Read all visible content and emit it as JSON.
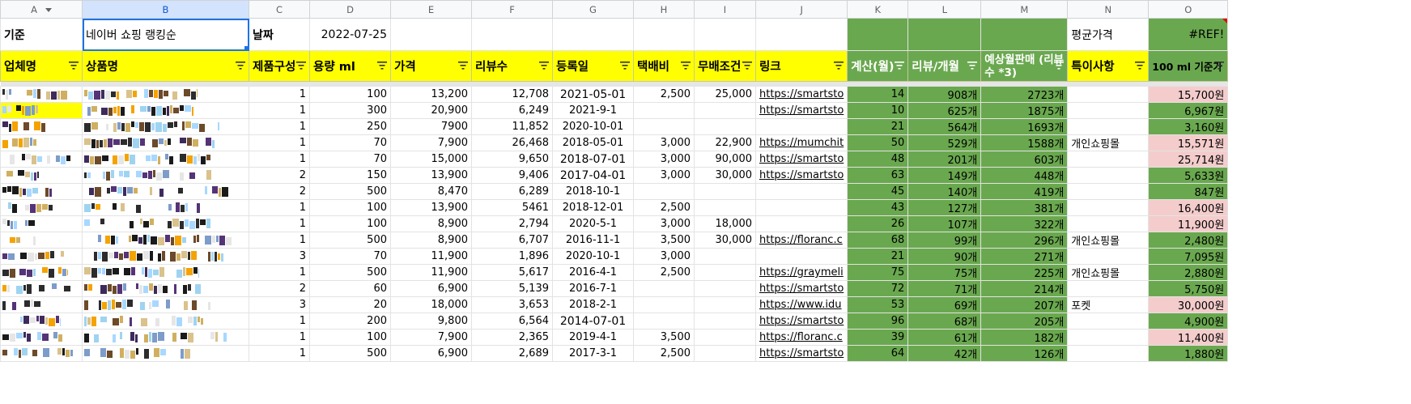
{
  "columns": [
    "A",
    "B",
    "C",
    "D",
    "E",
    "F",
    "G",
    "H",
    "I",
    "J",
    "K",
    "L",
    "M",
    "N",
    "O"
  ],
  "row1": {
    "a": "기준",
    "b": "네이버 쇼핑 랭킹순",
    "c": "날짜",
    "d": "2022-07-25",
    "n": "평균가격",
    "o": "#REF!"
  },
  "headers": {
    "a": "업체명",
    "b": "상품명",
    "c": "제품구성",
    "d": "용량 ml",
    "e": "가격",
    "f": "리뷰수",
    "g": "등록일",
    "h": "택배비",
    "i": "무배조건",
    "j": "링크",
    "k": "계산(월)",
    "l": "리뷰/개월",
    "m": "예상월판매 (리뷰수 *3)",
    "n": "특이사항",
    "o": "100 ml 기준가"
  },
  "rows": [
    {
      "c": "1",
      "d": "100",
      "e": "13,200",
      "f": "12,708",
      "g": "2021-05-01",
      "gbig": true,
      "h": "2,500",
      "i": "25,000",
      "j": "https://smartsto",
      "k": "14",
      "l": "908개",
      "m": "2723개",
      "n": "",
      "o": "15,700원",
      "pink": true
    },
    {
      "c": "1",
      "d": "300",
      "e": "20,900",
      "f": "6,249",
      "g": "2021-9-1",
      "gbig": false,
      "h": "",
      "i": "",
      "j": "https://smartsto",
      "k": "10",
      "l": "625개",
      "m": "1875개",
      "n": "",
      "o": "6,967원",
      "pink": false
    },
    {
      "c": "1",
      "d": "250",
      "e": "7900",
      "f": "11,852",
      "g": "2020-10-01",
      "gbig": false,
      "h": "",
      "i": "",
      "j": "",
      "k": "21",
      "l": "564개",
      "m": "1693개",
      "n": "",
      "o": "3,160원",
      "pink": false
    },
    {
      "c": "1",
      "d": "70",
      "e": "7,900",
      "f": "26,468",
      "g": "2018-05-01",
      "gbig": false,
      "h": "3,000",
      "i": "22,900",
      "j": "https://mumchit",
      "k": "50",
      "l": "529개",
      "m": "1588개",
      "n": "개인쇼핑몰",
      "o": "15,571원",
      "pink": true
    },
    {
      "c": "1",
      "d": "70",
      "e": "15,000",
      "f": "9,650",
      "g": "2018-07-01",
      "gbig": true,
      "h": "3,000",
      "i": "90,000",
      "j": "https://smartsto",
      "k": "48",
      "l": "201개",
      "m": "603개",
      "n": "",
      "o": "25,714원",
      "pink": true
    },
    {
      "c": "2",
      "d": "150",
      "e": "13,900",
      "f": "9,406",
      "g": "2017-04-01",
      "gbig": true,
      "h": "3,000",
      "i": "30,000",
      "j": "https://smartsto",
      "k": "63",
      "l": "149개",
      "m": "448개",
      "n": "",
      "o": "5,633원",
      "pink": false
    },
    {
      "c": "2",
      "d": "500",
      "e": "8,470",
      "f": "6,289",
      "g": "2018-10-1",
      "gbig": false,
      "h": "",
      "i": "",
      "j": "",
      "k": "45",
      "l": "140개",
      "m": "419개",
      "n": "",
      "o": "847원",
      "pink": false
    },
    {
      "c": "1",
      "d": "100",
      "e": "13,900",
      "f": "5461",
      "g": "2018-12-01",
      "gbig": false,
      "h": "2,500",
      "i": "",
      "j": "",
      "k": "43",
      "l": "127개",
      "m": "381개",
      "n": "",
      "o": "16,400원",
      "pink": true
    },
    {
      "c": "1",
      "d": "100",
      "e": "8,900",
      "f": "2,794",
      "g": "2020-5-1",
      "gbig": false,
      "h": "3,000",
      "i": "18,000",
      "j": "",
      "k": "26",
      "l": "107개",
      "m": "322개",
      "n": "",
      "o": "11,900원",
      "pink": true
    },
    {
      "c": "1",
      "d": "500",
      "e": "8,900",
      "f": "6,707",
      "g": "2016-11-1",
      "gbig": false,
      "h": "3,500",
      "i": "30,000",
      "j": "https://floranc.c",
      "k": "68",
      "l": "99개",
      "m": "296개",
      "n": "개인쇼핑몰",
      "o": "2,480원",
      "pink": false
    },
    {
      "c": "3",
      "d": "70",
      "e": "11,900",
      "f": "1,896",
      "g": "2020-10-1",
      "gbig": false,
      "h": "3,000",
      "i": "",
      "j": "",
      "k": "21",
      "l": "90개",
      "m": "271개",
      "n": "",
      "o": "7,095원",
      "pink": false
    },
    {
      "c": "1",
      "d": "500",
      "e": "11,900",
      "f": "5,617",
      "g": "2016-4-1",
      "gbig": false,
      "h": "2,500",
      "i": "",
      "j": "https://graymeli",
      "k": "75",
      "l": "75개",
      "m": "225개",
      "n": "개인쇼핑몰",
      "o": "2,880원",
      "pink": false
    },
    {
      "c": "2",
      "d": "60",
      "e": "6,900",
      "f": "5,139",
      "g": "2016-7-1",
      "gbig": false,
      "h": "",
      "i": "",
      "j": "https://smartsto",
      "k": "72",
      "l": "71개",
      "m": "214개",
      "n": "",
      "o": "5,750원",
      "pink": false
    },
    {
      "c": "3",
      "d": "20",
      "e": "18,000",
      "f": "3,653",
      "g": "2018-2-1",
      "gbig": false,
      "h": "",
      "i": "",
      "j": "https://www.idu",
      "k": "53",
      "l": "69개",
      "m": "207개",
      "n": "포켓",
      "o": "30,000원",
      "pink": true
    },
    {
      "c": "1",
      "d": "200",
      "e": "9,800",
      "f": "6,564",
      "g": "2014-07-01",
      "gbig": true,
      "h": "",
      "i": "",
      "j": "https://smartsto",
      "k": "96",
      "l": "68개",
      "m": "205개",
      "n": "",
      "o": "4,900원",
      "pink": false
    },
    {
      "c": "1",
      "d": "100",
      "e": "7,900",
      "f": "2,365",
      "g": "2019-4-1",
      "gbig": false,
      "h": "3,500",
      "i": "",
      "j": "https://floranc.c",
      "k": "39",
      "l": "61개",
      "m": "182개",
      "n": "",
      "o": "11,400원",
      "pink": true
    },
    {
      "c": "1",
      "d": "500",
      "e": "6,900",
      "f": "2,689",
      "g": "2017-3-1",
      "gbig": false,
      "h": "2,500",
      "i": "",
      "j": "https://smartsto",
      "k": "64",
      "l": "42개",
      "m": "126개",
      "n": "",
      "o": "1,880원",
      "pink": false
    }
  ],
  "colors": {
    "green": "#6aa84f",
    "yellow": "#ffff00",
    "pink": "#f4cccc",
    "link": "#1155cc",
    "red": "#e00000"
  }
}
